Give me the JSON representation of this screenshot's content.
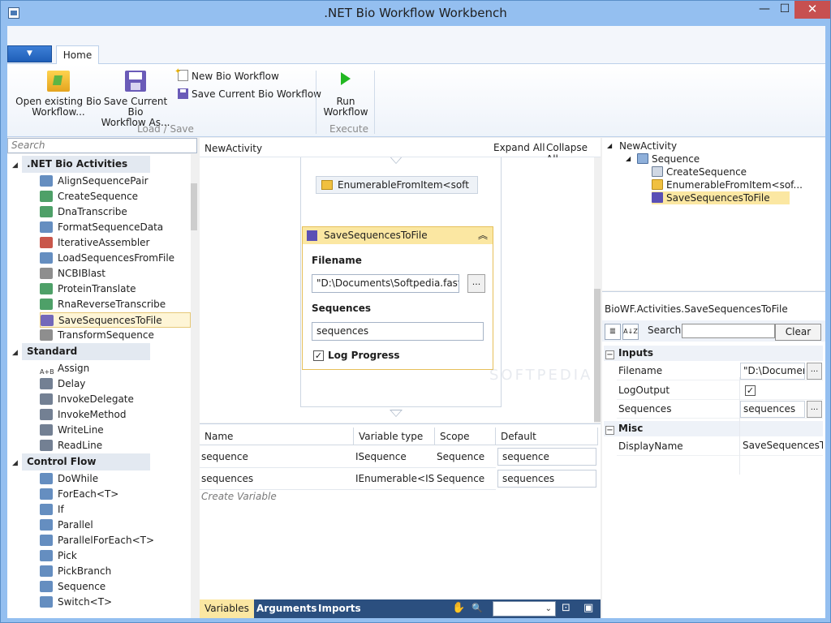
{
  "window": {
    "title": ".NET Bio Workflow Workbench",
    "min_glyph": "—",
    "max_glyph": "☐",
    "close_glyph": "✕"
  },
  "ribbon": {
    "app_menu_glyph": "▼",
    "tab_home": "Home",
    "open_workflow": "Open existing Bio Workflow...",
    "open_workflow_l1": "Open existing Bio",
    "open_workflow_l2": "Workflow...",
    "save_as_l1": "Save Current Bio",
    "save_as_l2": "Workflow As...",
    "new_workflow": "New Bio Workflow",
    "save_current": "Save Current Bio Workflow",
    "group_load_save": "Load / Save",
    "run_l1": "Run",
    "run_l2": "Workflow",
    "group_execute": "Execute"
  },
  "toolbox": {
    "search_placeholder": "Search",
    "categories": [
      {
        "name": ".NET Bio Activities",
        "items": [
          "AlignSequencePair",
          "CreateSequence",
          "DnaTranscribe",
          "FormatSequenceData",
          "IterativeAssembler",
          "LoadSequencesFromFile",
          "NCBIBlast",
          "ProteinTranslate",
          "RnaReverseTranscribe",
          "SaveSequencesToFile",
          "TransformSequence"
        ]
      },
      {
        "name": "Standard",
        "items": [
          "Assign",
          "Delay",
          "InvokeDelegate",
          "InvokeMethod",
          "WriteLine",
          "ReadLine"
        ]
      },
      {
        "name": "Control Flow",
        "items": [
          "DoWhile",
          "ForEach<T>",
          "If",
          "Parallel",
          "ParallelForEach<T>",
          "Pick",
          "PickBranch",
          "Sequence",
          "Switch<T>"
        ]
      }
    ],
    "selected": "SaveSequencesToFile",
    "assign_icon_text": "A+B"
  },
  "designer": {
    "breadcrumb": "NewActivity",
    "expand_all": "Expand All",
    "collapse_all": "Collapse All",
    "enum_activity": "EnumerableFromItem<soft",
    "save_activity": {
      "title": "SaveSequencesToFile",
      "filename_label": "Filename",
      "filename_value": "\"D:\\Documents\\Softpedia.fasta\"",
      "browse": "...",
      "sequences_label": "Sequences",
      "sequences_value": "sequences",
      "log_progress_label": "Log Progress",
      "log_progress_checked": "✓",
      "collapse_glyph": "︽"
    }
  },
  "variables": {
    "columns": [
      "Name",
      "Variable type",
      "Scope",
      "Default"
    ],
    "rows": [
      {
        "name": "sequence",
        "type": "ISequence",
        "scope": "Sequence",
        "default": "sequence"
      },
      {
        "name": "sequences",
        "type": "IEnumerable<ISeq",
        "scope": "Sequence",
        "default": "sequences"
      }
    ],
    "create_placeholder": "Create Variable"
  },
  "bottom_bar": {
    "variables": "Variables",
    "arguments": "Arguments",
    "imports": "Imports",
    "pan_icon": "✋",
    "zoom_icon": "🔍",
    "zoom_dropdown": "⌄",
    "fit_icon": "⊡",
    "overview_icon": "▣"
  },
  "outline": {
    "root": "NewActivity",
    "sequence": "Sequence",
    "children": [
      "CreateSequence",
      "EnumerableFromItem<sof...",
      "SaveSequencesToFile"
    ]
  },
  "properties": {
    "title": "BioWF.Activities.SaveSequencesToFile",
    "search_label": "Search:",
    "clear": "Clear",
    "cat_inputs": "Inputs",
    "cat_misc": "Misc",
    "collapse_box": "−",
    "sort_glyph": "A↓Z",
    "cat_glyph": "≣",
    "rows": [
      {
        "name": "Filename",
        "value": "\"D:\\Documen",
        "dots": "..."
      },
      {
        "name": "LogOutput",
        "value": "✓"
      },
      {
        "name": "Sequences",
        "value": "sequences",
        "dots": "..."
      }
    ],
    "misc_rows": [
      {
        "name": "DisplayName",
        "value": "SaveSequencesToF"
      }
    ]
  },
  "colors": {
    "accent": "#2b4f7f",
    "selection": "#fbe7a2",
    "window_frame": "#94bff0",
    "close_button": "#c75050"
  }
}
